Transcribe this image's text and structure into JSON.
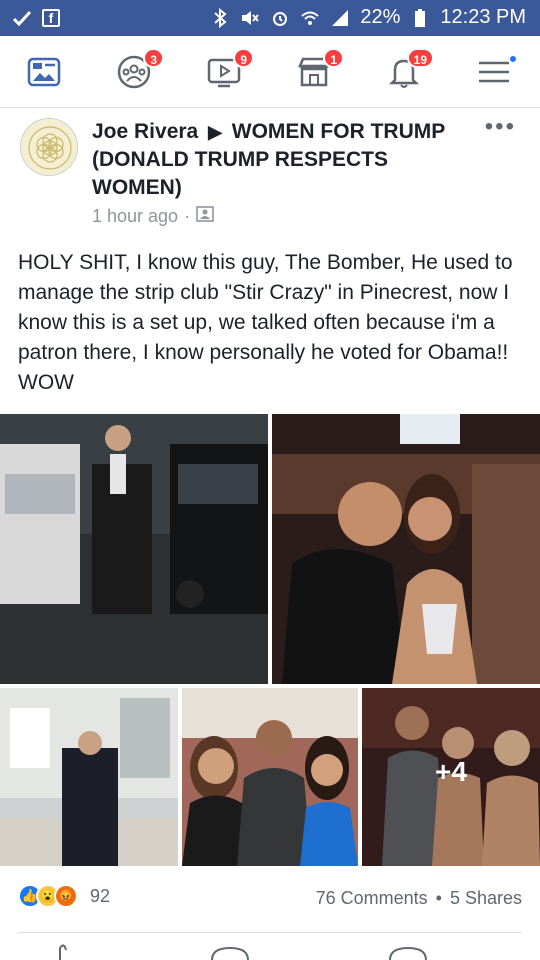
{
  "status_bar": {
    "battery": "22%",
    "time": "12:23 PM",
    "background": "#3b5998"
  },
  "nav": {
    "items": [
      {
        "icon": "news-feed-icon"
      },
      {
        "icon": "groups-icon",
        "badge": "3"
      },
      {
        "icon": "watch-icon",
        "badge": "9"
      },
      {
        "icon": "marketplace-icon",
        "badge": "1"
      },
      {
        "icon": "notifications-icon",
        "badge": "19"
      },
      {
        "icon": "menu-icon"
      }
    ]
  },
  "post": {
    "author": "Joe Rivera",
    "group": "WOMEN FOR TRUMP (DONALD TRUMP RESPECTS WOMEN)",
    "time": "1 hour ago",
    "separator": "·",
    "text": "HOLY SHIT, I know this guy, The Bomber, He used to manage the strip club \"Stir Crazy\" in Pinecrest, now I know this is a set up, we talked often because i'm a patron there, I know personally he voted for Obama!! WOW",
    "more_photos": "+4"
  },
  "footer": {
    "reaction_count": "92",
    "comments": "76 Comments",
    "separator": "•",
    "shares": "5 Shares"
  },
  "colors": {
    "brand": "#3b5998",
    "badge": "#fa3e3e",
    "icon_blue": "#4267b2"
  }
}
